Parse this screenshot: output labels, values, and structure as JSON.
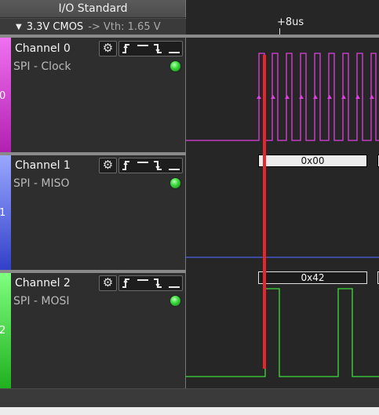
{
  "io_standard": {
    "title": "I/O Standard",
    "selected_value": "3.3V CMOS",
    "threshold": "-> Vth: 1.65 V"
  },
  "timeline": {
    "marker_label": "+8us"
  },
  "channels": [
    {
      "index_label": "0",
      "name": "Channel 0",
      "protocol": "SPI - Clock",
      "color": "#e040e0",
      "gradient": [
        "#f070f0",
        "#b020b0"
      ],
      "status": "active",
      "decode": []
    },
    {
      "index_label": "1",
      "name": "Channel 1",
      "protocol": "SPI - MISO",
      "color": "#4b5fe6",
      "gradient": [
        "#9aa8ff",
        "#3040c8"
      ],
      "status": "active",
      "decode": [
        "0x00"
      ]
    },
    {
      "index_label": "2",
      "name": "Channel 2",
      "protocol": "SPI - MOSI",
      "color": "#3fdc3f",
      "gradient": [
        "#80ff80",
        "#20b020"
      ],
      "status": "active",
      "decode": [
        "0x42"
      ]
    }
  ],
  "icons": {
    "settings": "gear-icon",
    "trigger_rising": "rising-edge-icon",
    "trigger_high": "high-level-icon",
    "trigger_falling": "falling-edge-icon",
    "trigger_low": "low-level-icon",
    "status": "status-led-icon"
  },
  "cursor_color": "#e8262a"
}
